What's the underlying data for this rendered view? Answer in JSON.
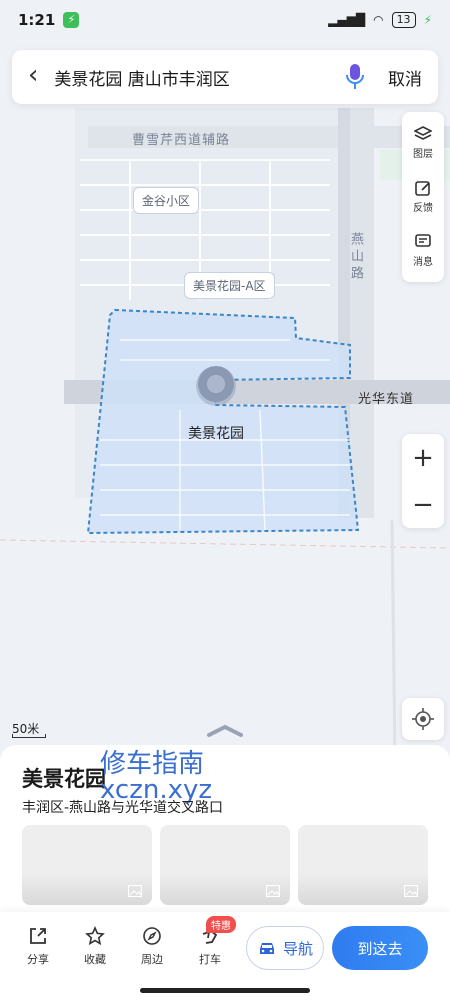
{
  "status": {
    "time": "1:21",
    "battery": "13"
  },
  "search": {
    "query": "美景花园 唐山市丰润区",
    "cancel": "取消"
  },
  "tools": {
    "layers": "图层",
    "feedback": "反馈",
    "messages": "消息"
  },
  "zoom": {
    "in": "+",
    "out": "−"
  },
  "map": {
    "roads": {
      "top": "曹雪芹西道辅路",
      "vertical": "燕山路",
      "east": "光华东道"
    },
    "pois": {
      "jingu": "金谷小区",
      "area_a": "美景花园-A区",
      "main": "美景花园"
    },
    "scale": "50米"
  },
  "place": {
    "name": "美景花园",
    "address": "丰润区-燕山路与光华道交叉路口",
    "watermark_line1": "修车指南",
    "watermark_line2": "xczn.xyz"
  },
  "actions": {
    "share": "分享",
    "favorite": "收藏",
    "nearby": "周边",
    "taxi": "打车",
    "taxi_badge": "特惠",
    "navigate": "导航",
    "go_here": "到这去"
  },
  "colors": {
    "accent": "#2f7bf0",
    "area_fill": "#cfe0f7",
    "area_stroke": "#3a86c8"
  }
}
